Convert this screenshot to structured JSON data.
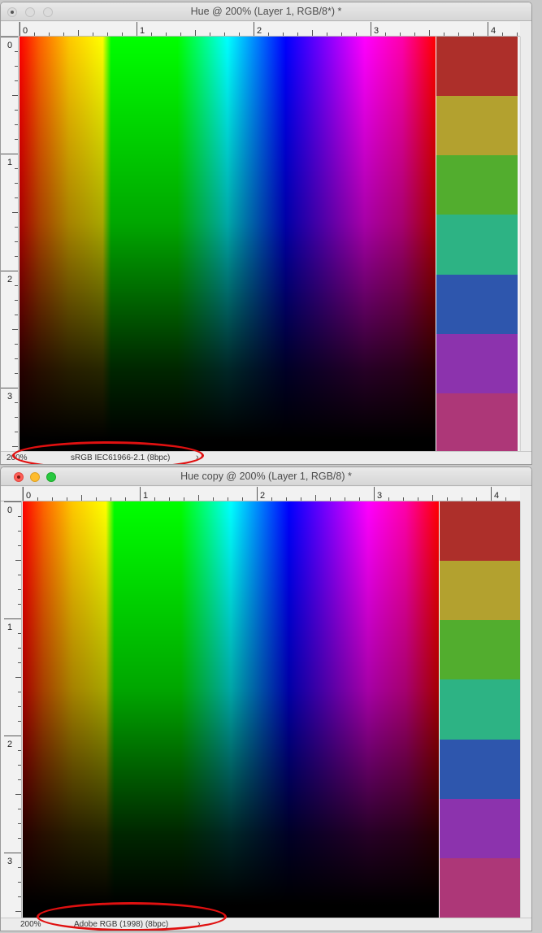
{
  "windows": [
    {
      "title": "Hue @ 200% (Layer 1, RGB/8*) *",
      "active": false,
      "zoom": "200%",
      "profile": "sRGB IEC61966-2.1 (8bpc)",
      "chevron": "›",
      "ruler_h_labels": [
        "0",
        "1",
        "2",
        "3",
        "4"
      ],
      "ruler_v_labels": [
        "0",
        "1",
        "2",
        "3"
      ],
      "swatch_colors": [
        "#ad2f2a",
        "#b3a12f",
        "#52ad2e",
        "#2db384",
        "#2e56ad",
        "#8c33ad",
        "#ad3778"
      ]
    },
    {
      "title": "Hue copy @ 200% (Layer 1, RGB/8) *",
      "active": true,
      "zoom": "200%",
      "profile": "Adobe RGB (1998) (8bpc)",
      "chevron": "›",
      "ruler_h_labels": [
        "0",
        "1",
        "2",
        "3",
        "4"
      ],
      "ruler_v_labels": [
        "0",
        "1",
        "2",
        "3"
      ],
      "swatch_colors": [
        "#ad2f2a",
        "#b3a12f",
        "#52ad2e",
        "#2db384",
        "#2e56ad",
        "#8c33ad",
        "#ad3778"
      ]
    }
  ],
  "annotation_color": "#e01010"
}
